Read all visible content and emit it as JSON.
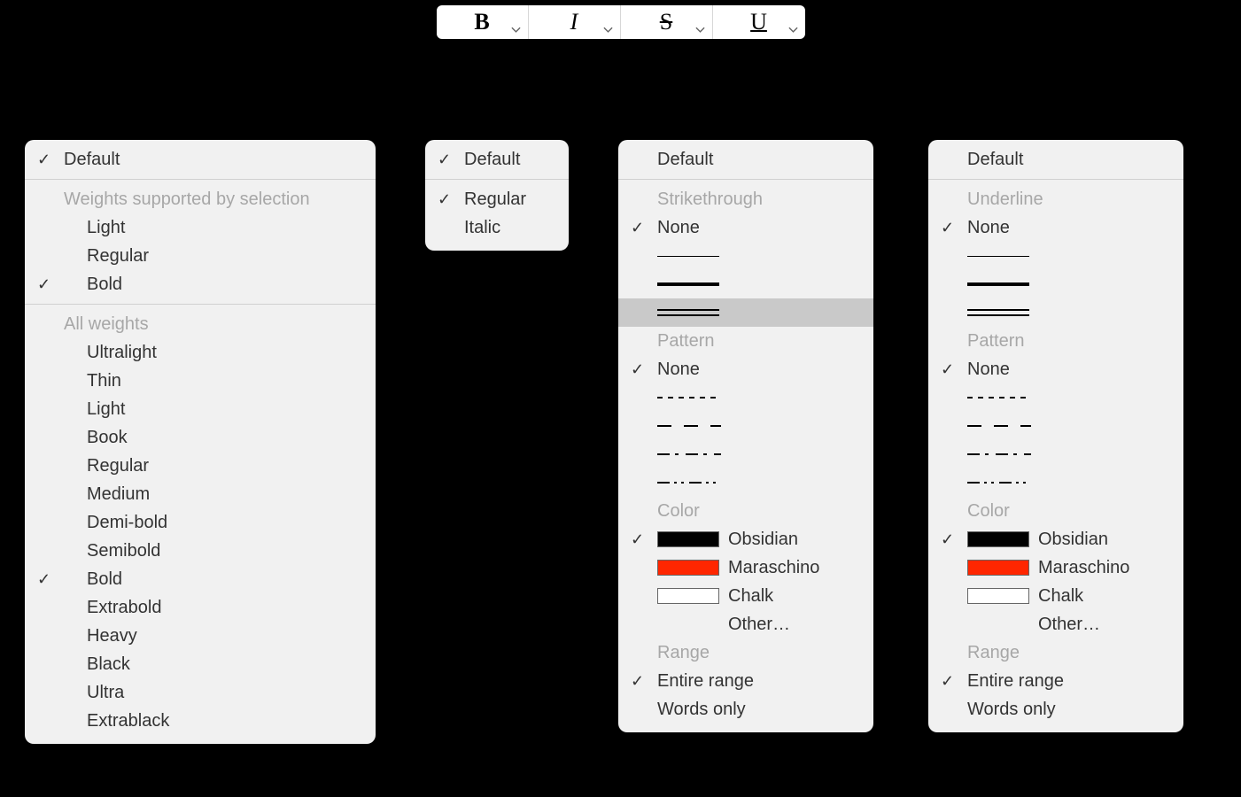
{
  "toolbar": {
    "bold_label": "B",
    "italic_label": "I",
    "strike_label": "S",
    "underline_label": "U"
  },
  "common": {
    "default": "Default"
  },
  "bold_menu": {
    "section1": "Weights supported by selection",
    "supported": [
      "Light",
      "Regular",
      "Bold"
    ],
    "supported_checked": "Bold",
    "section2": "All weights",
    "all": [
      "Ultralight",
      "Thin",
      "Light",
      "Book",
      "Regular",
      "Medium",
      "Demi-bold",
      "Semibold",
      "Bold",
      "Extrabold",
      "Heavy",
      "Black",
      "Ultra",
      "Extrablack"
    ],
    "all_checked": "Bold"
  },
  "italic_menu": {
    "items": [
      "Regular",
      "Italic"
    ],
    "checked": "Regular"
  },
  "line_menu": {
    "style_header_strike": "Strikethrough",
    "style_header_under": "Underline",
    "none": "None",
    "pattern_header": "Pattern",
    "pattern_none": "None",
    "color_header": "Color",
    "colors": [
      {
        "name": "Obsidian",
        "hex": "#000000"
      },
      {
        "name": "Maraschino",
        "hex": "#ff2600"
      },
      {
        "name": "Chalk",
        "hex": "#ffffff"
      }
    ],
    "other": "Other…",
    "range_header": "Range",
    "range_entire": "Entire range",
    "range_words": "Words only"
  }
}
